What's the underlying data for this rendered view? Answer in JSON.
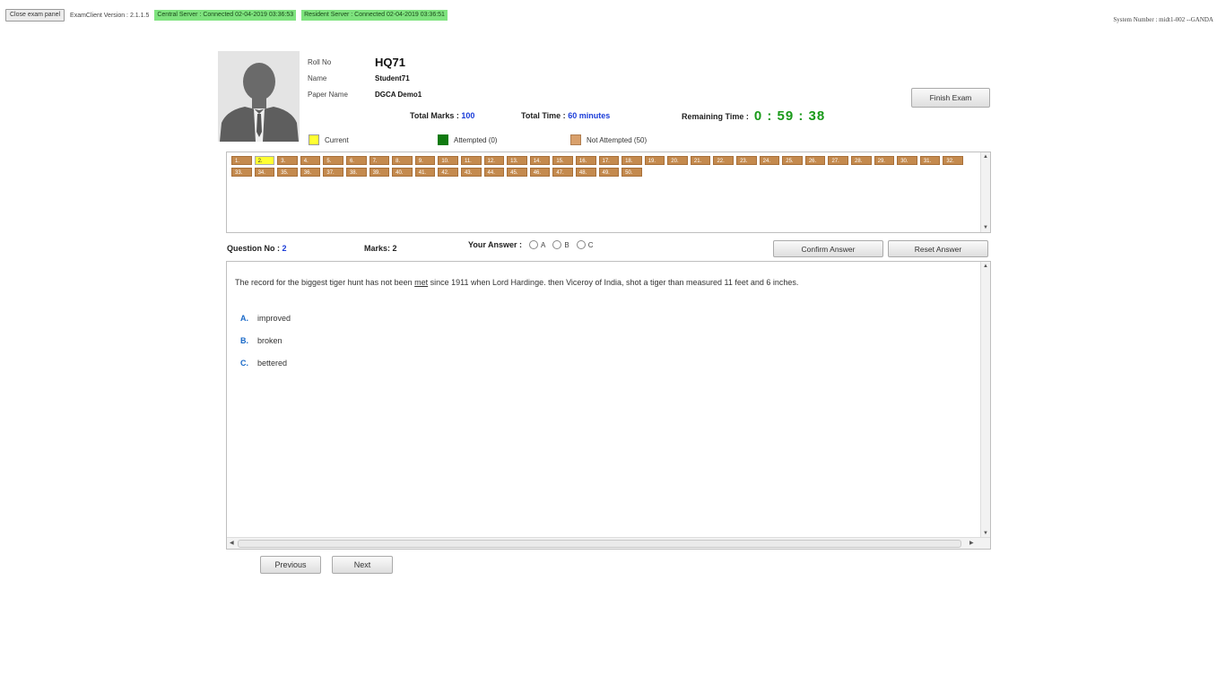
{
  "topbar": {
    "close_label": "Close exam panel",
    "version": "ExamClient Version : 2.1.1.5",
    "central_server": "Central Server : Connected 02-04-2019 03:36:53",
    "resident_server": "Resident Server : Connected 02-04-2019 03:36:51",
    "system_number": "System Number : midt1-002 --GANDA"
  },
  "candidate": {
    "roll_label": "Roll No",
    "roll_value": "HQ71",
    "name_label": "Name",
    "name_value": "Student71",
    "paper_label": "Paper Name",
    "paper_value": "DGCA Demo1"
  },
  "summary": {
    "total_marks_label": "Total Marks :",
    "total_marks": "100",
    "total_time_label": "Total Time :",
    "total_time": "60 minutes",
    "remaining_label": "Remaining Time :",
    "remaining": "0 : 59 : 38"
  },
  "finish_label": "Finish Exam",
  "legend": {
    "current": "Current",
    "attempted": "Attempted (0)",
    "not_attempted": "Not Attempted (50)"
  },
  "palette": {
    "current_question": 2,
    "questions": [
      "1.",
      "2.",
      "3.",
      "4.",
      "5.",
      "6.",
      "7.",
      "8.",
      "9.",
      "10.",
      "11.",
      "12.",
      "13.",
      "14.",
      "15.",
      "16.",
      "17.",
      "18.",
      "19.",
      "20.",
      "21.",
      "22.",
      "23.",
      "24.",
      "25.",
      "26.",
      "27.",
      "28.",
      "29.",
      "30.",
      "31.",
      "32.",
      "33.",
      "34.",
      "35.",
      "36.",
      "37.",
      "38.",
      "39.",
      "40.",
      "41.",
      "42.",
      "43.",
      "44.",
      "45.",
      "46.",
      "47.",
      "48.",
      "49.",
      "50."
    ]
  },
  "question_meta": {
    "qno_label": "Question No :",
    "qno": "2",
    "marks_label": "Marks: 2",
    "answer_label": "Your Answer :",
    "options": [
      "A",
      "B",
      "C"
    ]
  },
  "confirm_label": "Confirm Answer",
  "reset_label": "Reset Answer",
  "question": {
    "text_before": "The record for the biggest tiger hunt has not been ",
    "text_underlined": "met",
    "text_after": " since 1911 when Lord Hardinge. then Viceroy of India, shot a tiger than measured 11 feet and 6 inches.",
    "options": [
      {
        "key": "A.",
        "text": "improved"
      },
      {
        "key": "B.",
        "text": "broken"
      },
      {
        "key": "C.",
        "text": "bettered"
      }
    ]
  },
  "nav": {
    "previous": "Previous",
    "next": "Next"
  },
  "colors": {
    "current": "#ffff33",
    "attempted": "#0f7a0f",
    "not_attempted": "#c48a4e",
    "timer": "#1a9a1a",
    "server_ok": "#7ee37e",
    "value_blue": "#1a3cd8"
  }
}
